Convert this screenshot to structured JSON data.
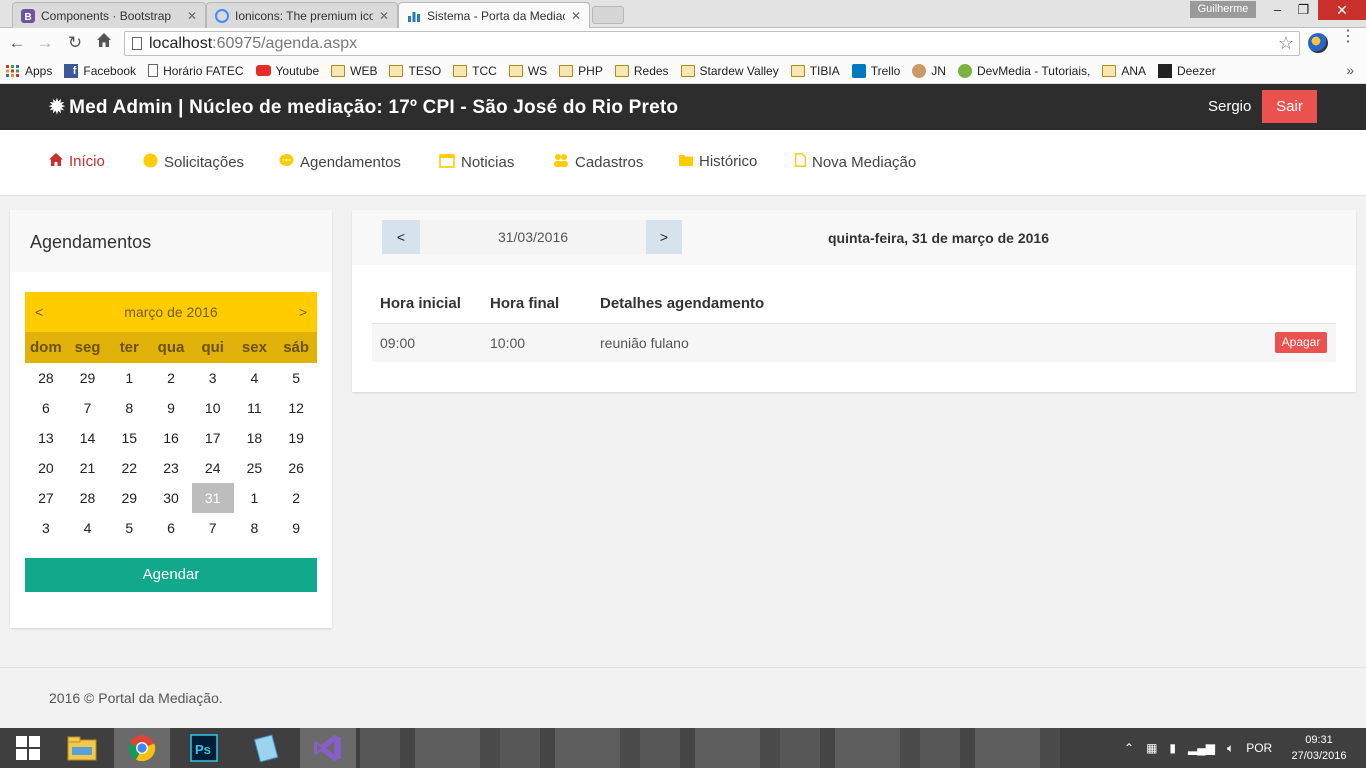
{
  "browser": {
    "tabs": [
      {
        "title": "Components · Bootstrap",
        "icon": "bootstrap-icon",
        "active": false
      },
      {
        "title": "Ionicons: The premium ico",
        "icon": "ionicons-icon",
        "active": false
      },
      {
        "title": "Sistema - Porta da Mediaç",
        "icon": "bar-chart-icon",
        "active": true
      }
    ],
    "profile_name": "Guilherme",
    "url_host": "localhost",
    "url_path": ":60975/agenda.aspx",
    "bookmarks": [
      {
        "label": "Apps",
        "icon": "apps-grid-icon"
      },
      {
        "label": "Facebook",
        "icon": "facebook-icon"
      },
      {
        "label": "Horário FATEC",
        "icon": "page-icon"
      },
      {
        "label": "Youtube",
        "icon": "youtube-icon"
      },
      {
        "label": "WEB",
        "icon": "folder-icon"
      },
      {
        "label": "TESO",
        "icon": "folder-icon"
      },
      {
        "label": "TCC",
        "icon": "folder-icon"
      },
      {
        "label": "WS",
        "icon": "folder-icon"
      },
      {
        "label": "PHP",
        "icon": "folder-icon"
      },
      {
        "label": "Redes",
        "icon": "folder-icon"
      },
      {
        "label": "Stardew Valley",
        "icon": "folder-icon"
      },
      {
        "label": "TIBIA",
        "icon": "folder-icon"
      },
      {
        "label": "Trello",
        "icon": "trello-icon"
      },
      {
        "label": "JN",
        "icon": "avatar-icon"
      },
      {
        "label": "DevMedia - Tutoriais,",
        "icon": "devmedia-icon"
      },
      {
        "label": "ANA",
        "icon": "folder-icon"
      },
      {
        "label": "Deezer",
        "icon": "deezer-icon"
      }
    ]
  },
  "header": {
    "brand": "Med Admin | Núcleo de mediação: 17º CPI - São José do Rio Preto",
    "username": "Sergio",
    "logout_label": "Sair"
  },
  "nav": {
    "items": [
      {
        "label": "Início",
        "icon": "home-icon",
        "active": true
      },
      {
        "label": "Solicitações",
        "icon": "circle-icon"
      },
      {
        "label": "Agendamentos",
        "icon": "chat-bubble-icon"
      },
      {
        "label": "Noticias",
        "icon": "calendar-icon"
      },
      {
        "label": "Cadastros",
        "icon": "people-icon"
      },
      {
        "label": "Histórico",
        "icon": "folder-icon"
      },
      {
        "label": "Nova Mediação",
        "icon": "document-icon"
      }
    ]
  },
  "sidebar": {
    "title": "Agendamentos",
    "calendar": {
      "prev": "<",
      "next": ">",
      "month": "março de 2016",
      "weekdays": [
        "dom",
        "seg",
        "ter",
        "qua",
        "qui",
        "sex",
        "sáb"
      ],
      "days": [
        "28",
        "29",
        "1",
        "2",
        "3",
        "4",
        "5",
        "6",
        "7",
        "8",
        "9",
        "10",
        "11",
        "12",
        "13",
        "14",
        "15",
        "16",
        "17",
        "18",
        "19",
        "20",
        "21",
        "22",
        "23",
        "24",
        "25",
        "26",
        "27",
        "28",
        "29",
        "30",
        "31",
        "1",
        "2",
        "3",
        "4",
        "5",
        "6",
        "7",
        "8",
        "9"
      ],
      "selected_day": "31"
    },
    "schedule_button": "Agendar"
  },
  "main": {
    "prev_label": "<",
    "date_value": "31/03/2016",
    "next_label": ">",
    "date_long": "quinta-feira, 31 de março de 2016",
    "table": {
      "headers": [
        "Hora inicial",
        "Hora final",
        "Detalhes agendamento"
      ],
      "rows": [
        {
          "start": "09:00",
          "end": "10:00",
          "details": "reunião fulano",
          "action": "Apagar"
        }
      ]
    }
  },
  "footer": {
    "text": "2016 © Portal da Mediação."
  },
  "taskbar": {
    "lang": "POR",
    "time": "09:31",
    "date": "27/03/2016"
  },
  "colors": {
    "header_bg": "#2d2d2d",
    "danger": "#e9524f",
    "calendar_yellow": "#ffcc00",
    "calendar_dow": "#e0b20a",
    "teal": "#12a88c",
    "active_nav": "#c9302c"
  }
}
